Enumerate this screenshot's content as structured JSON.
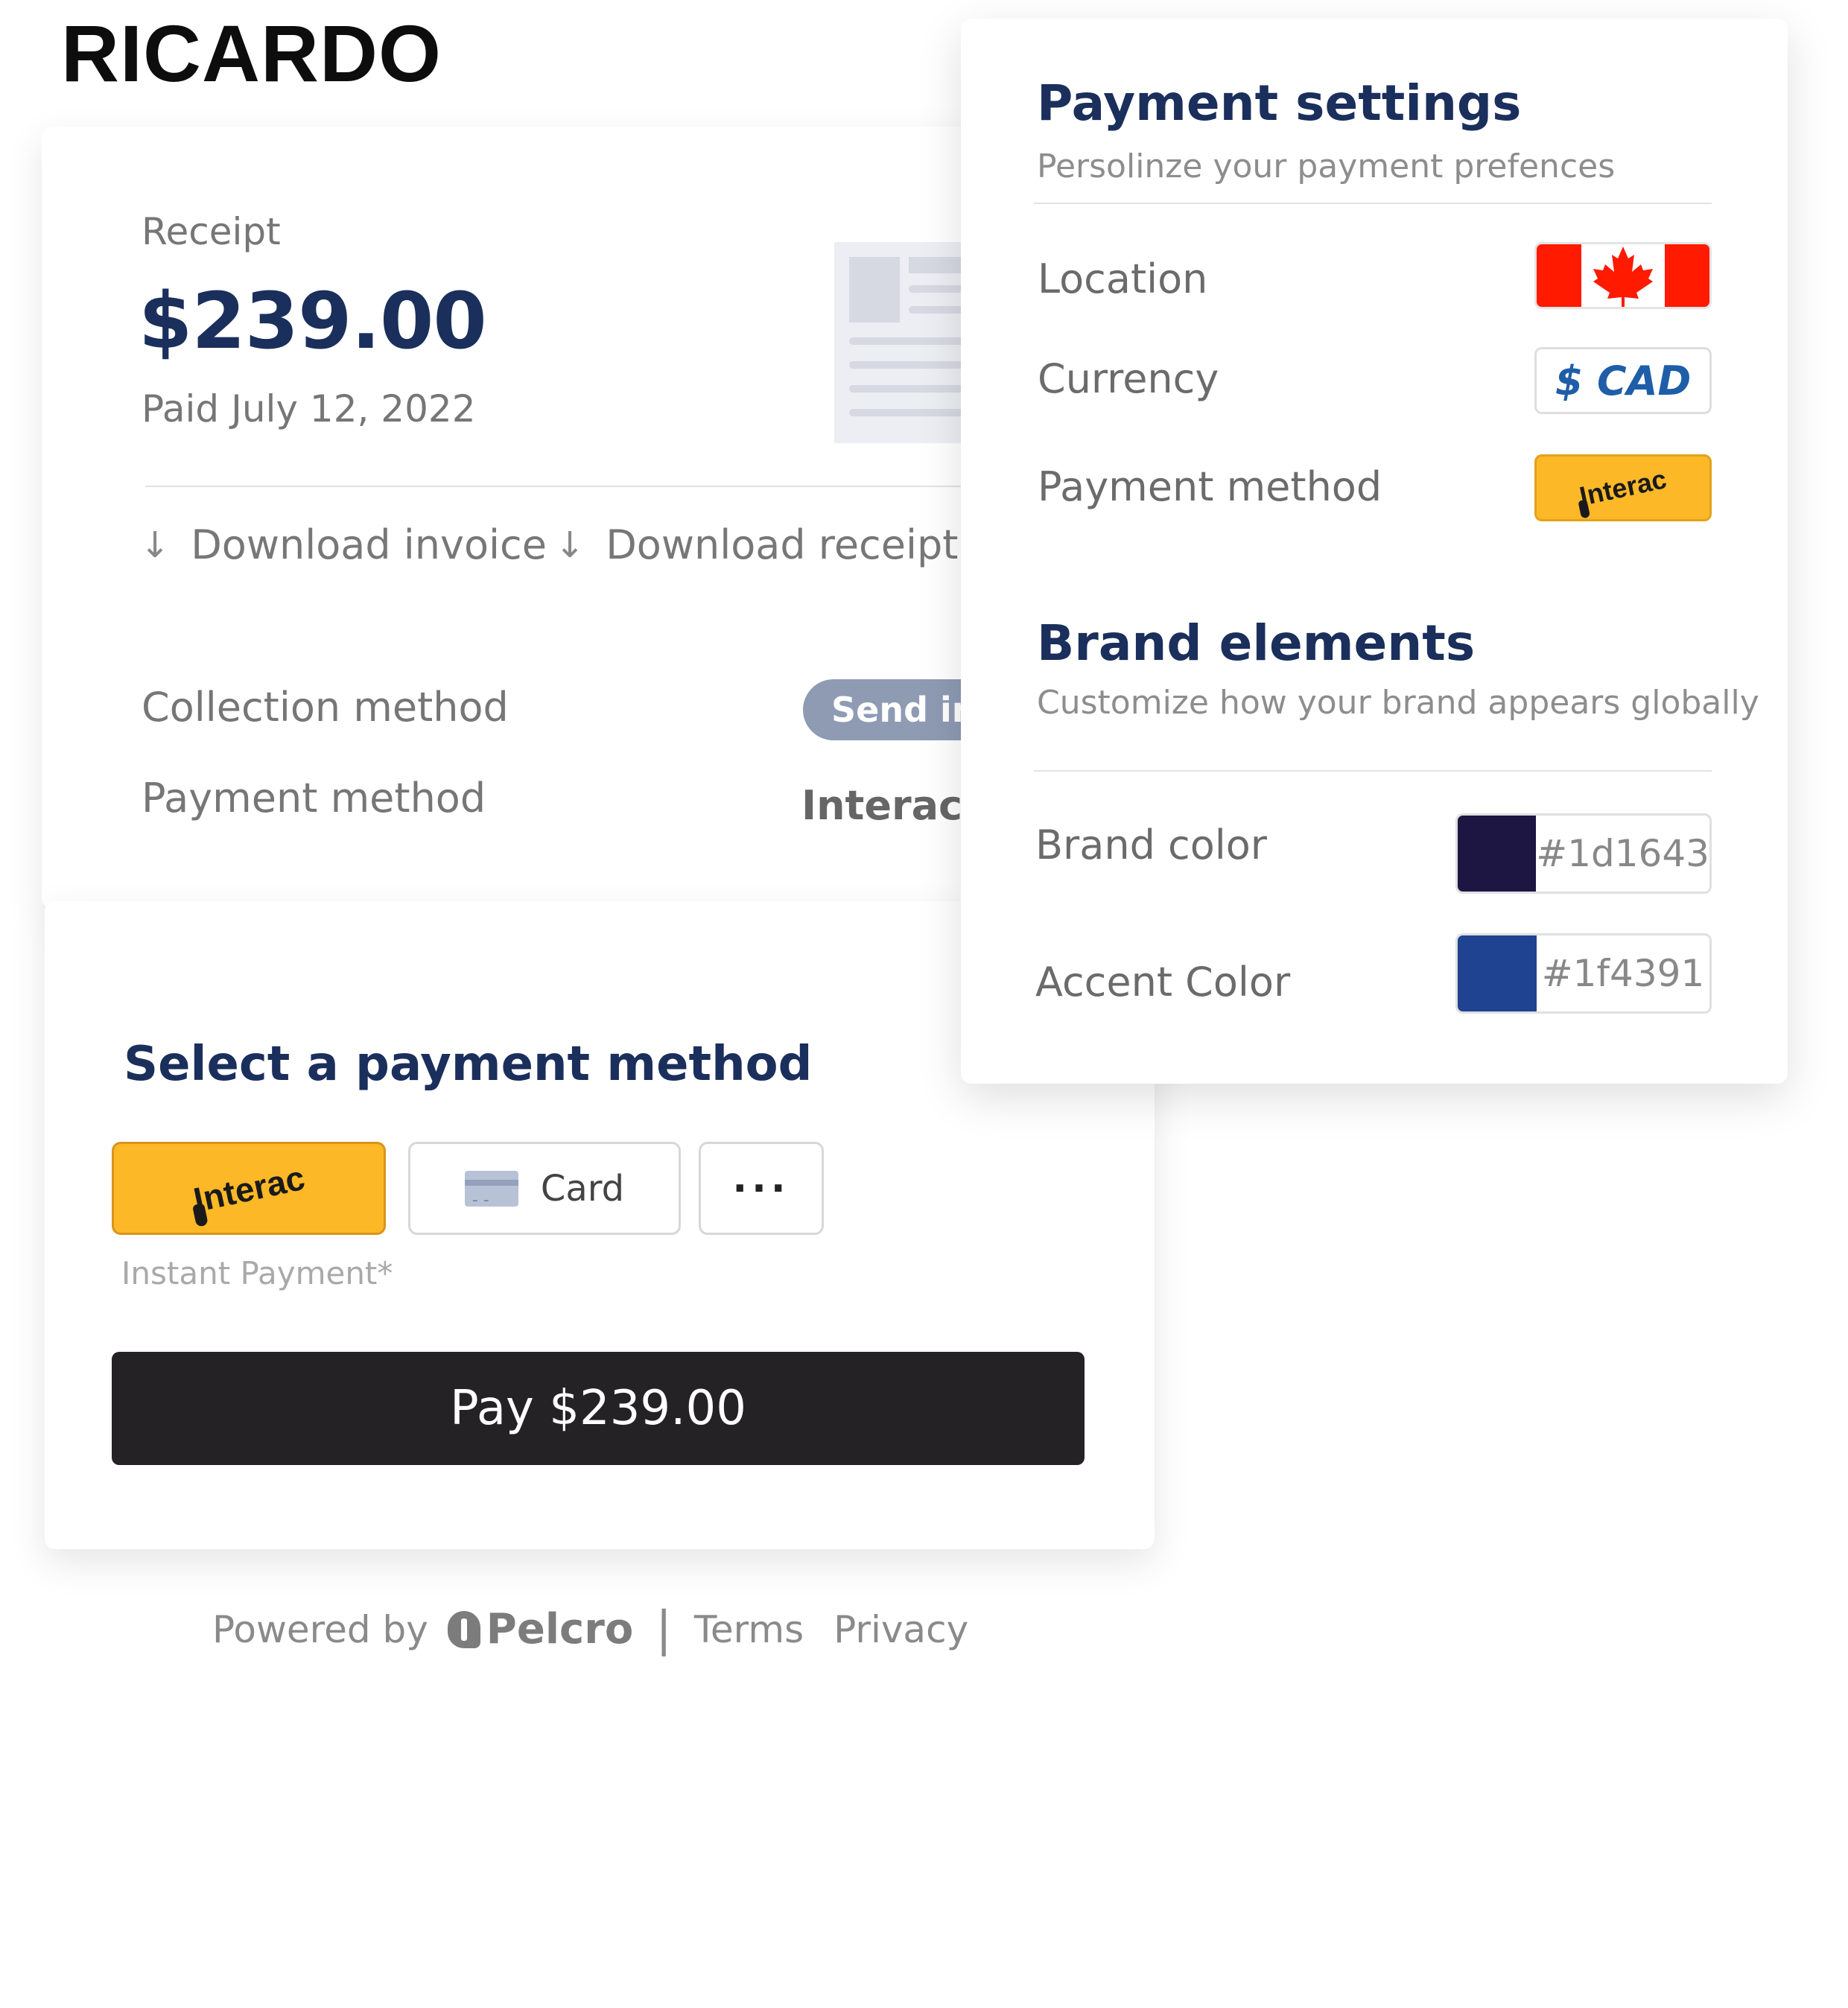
{
  "brand": {
    "logo_text": "RICARDO"
  },
  "receipt": {
    "label": "Receipt",
    "amount": "$239.00",
    "paid_date": "Paid July 12, 2022",
    "download_invoice": "Download invoice",
    "download_receipt": "Download receipt",
    "collection_method_label": "Collection method",
    "collection_method_value": "Send invoice",
    "payment_method_label": "Payment method",
    "payment_method_value": "Interac -"
  },
  "payment": {
    "title": "Select a payment method",
    "options": {
      "interac": "Interac",
      "card": "Card",
      "more": "···"
    },
    "instant_label": "Instant Payment*",
    "pay_button": "Pay $239.00"
  },
  "footer": {
    "powered_by": "Powered by",
    "pelcro": "Pelcro",
    "separator": "|",
    "terms": "Terms",
    "privacy": "Privacy"
  },
  "settings": {
    "title": "Payment settings",
    "subtitle": "Persolinze your payment prefences",
    "location_label": "Location",
    "currency_label": "Currency",
    "currency_value": "$ CAD",
    "method_label": "Payment method",
    "method_value": "Interac",
    "brand_title": "Brand elements",
    "brand_subtitle": "Customize how your brand appears globally",
    "brand_color_label": "Brand color",
    "brand_color_hex": "#1d1643",
    "accent_color_label": "Accent Color",
    "accent_color_hex": "#1f4391"
  },
  "colors": {
    "brand": "#1d1643",
    "accent": "#1f4391",
    "heading_navy": "#1b2f5c",
    "interac_yellow": "#fdb827",
    "pay_button": "#252225",
    "flag_red": "#ff1a00"
  },
  "icons": {
    "download": "arrow-down-icon",
    "flag": "canada-flag-icon",
    "card": "credit-card-icon",
    "more": "more-horizontal-icon",
    "pelcro": "pelcro-logo-icon"
  }
}
